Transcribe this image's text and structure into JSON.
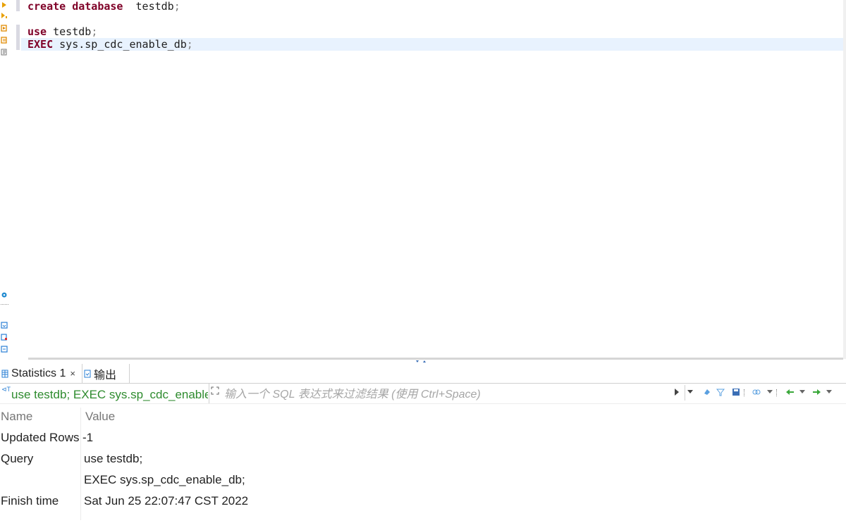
{
  "editor": {
    "lines": [
      {
        "kw": "create database",
        "rest": "  testdb",
        "semi": ";"
      },
      {
        "kw": "",
        "rest": "",
        "semi": ""
      },
      {
        "kw": "use",
        "rest": " testdb",
        "semi": ";"
      },
      {
        "kw": "EXEC",
        "rest": " sys.sp_cdc_enable_db",
        "semi": ";"
      }
    ],
    "gutter_icons": [
      "execute-statement-icon",
      "execute-script-icon",
      "execute-in-new-tab-icon",
      "explain-plan-icon",
      "format-sql-icon"
    ],
    "side_icons": [
      "settings-gear-icon",
      "load-script-icon",
      "save-script-icon",
      "export-script-icon"
    ]
  },
  "results": {
    "tabs": [
      {
        "label": "Statistics 1",
        "active": true,
        "closable": true
      },
      {
        "label": "输出",
        "active": false,
        "closable": false
      }
    ],
    "query_text": "use testdb; EXEC sys.sp_cdc_enable_db;",
    "filter_placeholder": "输入一个 SQL 表达式来过滤结果 (使用 Ctrl+Space)",
    "grid": {
      "headers": {
        "name": "Name",
        "value": "Value"
      },
      "rows": [
        {
          "name": "Updated Rows",
          "value": "-1"
        },
        {
          "name": "Query",
          "value": "use testdb;"
        },
        {
          "name": "",
          "value": "EXEC sys.sp_cdc_enable_db;"
        },
        {
          "name": "Finish time",
          "value": "Sat Jun 25 22:07:47 CST 2022"
        }
      ]
    },
    "toolbar_icons": [
      "run-filter-icon",
      "filter-history-dropdown-icon",
      "clear-filter-icon",
      "filter-settings-icon",
      "save-filter-icon",
      "link-icon",
      "back-arrow-icon",
      "forward-arrow-icon"
    ]
  },
  "colors": {
    "keyword": "#7f0027",
    "active_line": "#e8f2fe",
    "query_text": "#2e8b2e",
    "accent": "#2a7fd4",
    "gutter_icon": "#e8a000"
  }
}
